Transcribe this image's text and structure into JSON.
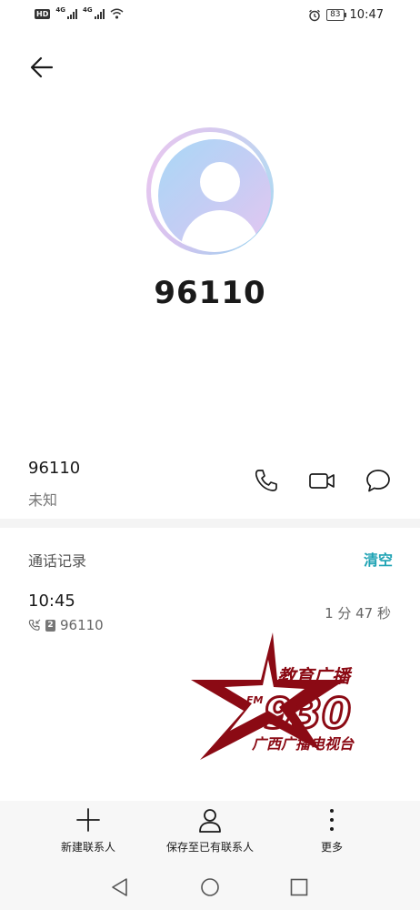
{
  "status_bar": {
    "hd": "HD",
    "network_1": "4G",
    "network_2": "4G",
    "battery": "83",
    "time": "10:47"
  },
  "contact": {
    "title": "96110",
    "number": "96110",
    "location": "未知"
  },
  "actions": {
    "call_icon": "phone-icon",
    "video_icon": "video-camera-icon",
    "message_icon": "message-bubble-icon"
  },
  "call_log": {
    "title": "通话记录",
    "clear_label": "清空",
    "entries": [
      {
        "time": "10:45",
        "sim": "2",
        "number": "96110",
        "duration": "1 分 47 秒"
      }
    ]
  },
  "watermark": {
    "line1": "教育广播",
    "line2": "FM",
    "line3": "930",
    "line4": "广西广播电视台"
  },
  "bottom_actions": [
    {
      "label": "新建联系人",
      "icon": "plus-icon"
    },
    {
      "label": "保存至已有联系人",
      "icon": "person-icon"
    },
    {
      "label": "更多",
      "icon": "more-vertical-icon"
    }
  ],
  "colors": {
    "accent": "#1fa3b4",
    "watermark": "#8b0a14"
  }
}
